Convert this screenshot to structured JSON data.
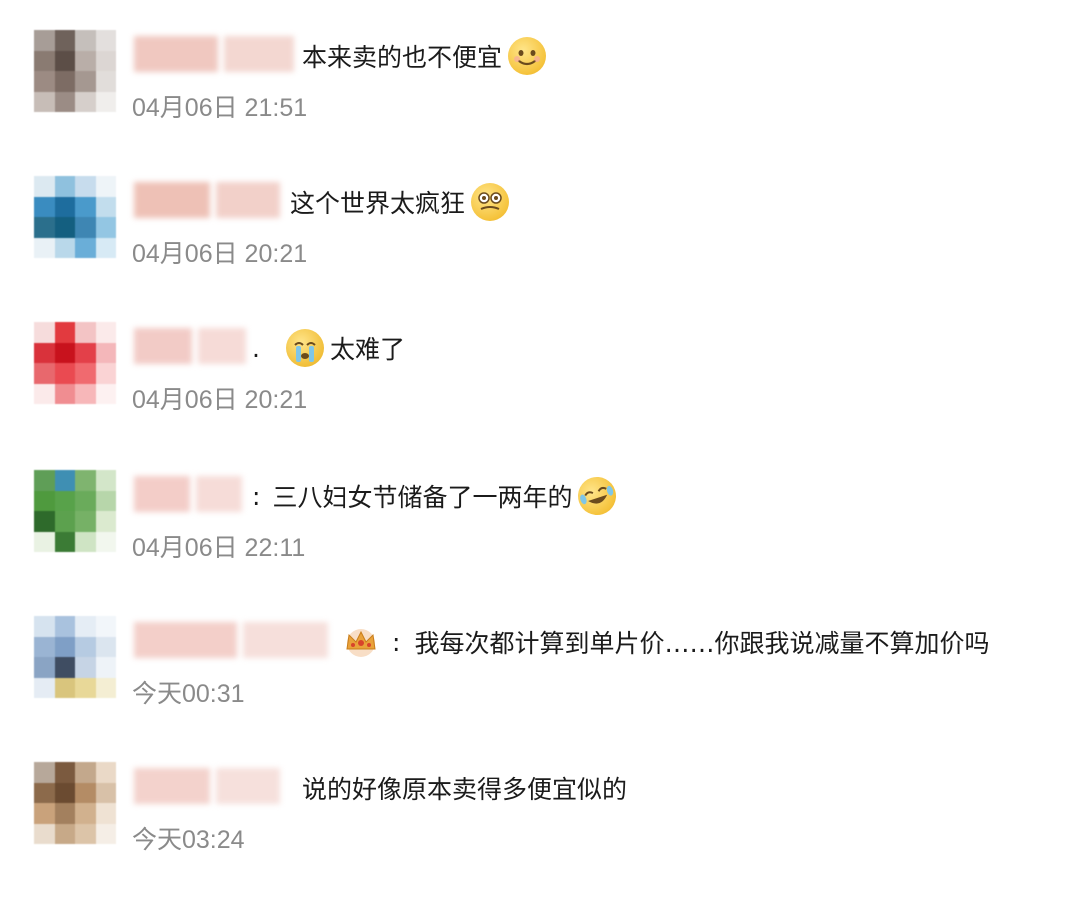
{
  "comments": [
    {
      "separator": "",
      "text": "本来卖的也不便宜",
      "emoji": "smiling-face",
      "time": "04月06日 21:51",
      "avatar_colors": [
        "#a79d97",
        "#6f625b",
        "#c5bfbb",
        "#e3dfdd",
        "#8a7b72",
        "#5c4e47",
        "#b9aea8",
        "#dcd6d3",
        "#9c8b83",
        "#7d6c64",
        "#a59891",
        "#e1ddda",
        "#c7bdb7",
        "#9b8c85",
        "#d6cfcb",
        "#f0eeec"
      ],
      "username_colors": [
        "#f0c8c0",
        "#f3d7d1"
      ]
    },
    {
      "separator": "",
      "text": "这个世界太疯狂",
      "emoji": "crazy-face",
      "time": "04月06日 20:21",
      "avatar_colors": [
        "#dce9f1",
        "#8fc1de",
        "#c7dced",
        "#eef4f8",
        "#3a8cc0",
        "#1e6d9e",
        "#4a9acb",
        "#c2dded",
        "#2b6f8c",
        "#145f80",
        "#3e86b3",
        "#93c6e3",
        "#e9f1f6",
        "#b9d8ea",
        "#6aaed8",
        "#d7eaf5"
      ],
      "username_colors": [
        "#eec1b6",
        "#f2d0c9"
      ]
    },
    {
      "separator": ".",
      "text": "太难了",
      "emoji": "crying-face",
      "time": "04月06日 20:21",
      "avatar_colors": [
        "#f6dcdc",
        "#e23a3f",
        "#f3c4c5",
        "#fbeaea",
        "#d9323b",
        "#c8121d",
        "#e34049",
        "#f4b7ba",
        "#e8686d",
        "#ea4a51",
        "#f06a6f",
        "#fad3d4",
        "#fbeaea",
        "#f08d91",
        "#f7b7b9",
        "#fdf1f1"
      ],
      "username_colors": [
        "#f2cbc6",
        "#f6dbd7"
      ]
    },
    {
      "separator": ":",
      "text": "三八妇女节储备了一两年的",
      "emoji": "laugh-crying-face",
      "time": "04月06日 22:11",
      "avatar_colors": [
        "#5f9e57",
        "#3f8fb3",
        "#7fb46f",
        "#d3e6c9",
        "#4f9a3e",
        "#58a24a",
        "#6aab5b",
        "#b7d6aa",
        "#2e6a2b",
        "#5ca14e",
        "#76b166",
        "#dbeacf",
        "#e9f2e3",
        "#3b7b35",
        "#cfe4c4",
        "#f2f7ee"
      ],
      "username_colors": [
        "#f3cdc8",
        "#f6dcd8"
      ]
    },
    {
      "separator": ":",
      "text": "我每次都计算到单片价……你跟我说减量不算加价吗",
      "emoji": "",
      "time": "今天00:31",
      "avatar_colors": [
        "#d6e3ef",
        "#a9c2de",
        "#e5edf5",
        "#f2f6fa",
        "#9ab4d3",
        "#7f9fc6",
        "#b6cbe2",
        "#dbe5ef",
        "#8aa4c4",
        "#3f4d62",
        "#c6d4e5",
        "#eef3f8",
        "#e5ecf4",
        "#d9c57d",
        "#e8d898",
        "#f4eed3"
      ],
      "username_colors": [
        "#f3cfc9",
        "#f6dfdb"
      ]
    },
    {
      "separator": "",
      "text": "说的好像原本卖得多便宜似的",
      "emoji": "",
      "time": "今天03:24",
      "avatar_colors": [
        "#b7a89a",
        "#7b5a3f",
        "#c3a88c",
        "#ead9c7",
        "#8c6a4b",
        "#6b4b31",
        "#b48c65",
        "#d8c1a8",
        "#c9a27b",
        "#a3805e",
        "#d1b18e",
        "#efe2d3",
        "#e9dccd",
        "#c7a988",
        "#dcc4a8",
        "#f5eee6"
      ],
      "username_colors": [
        "#f3d2cc",
        "#f6e0dc"
      ]
    }
  ]
}
